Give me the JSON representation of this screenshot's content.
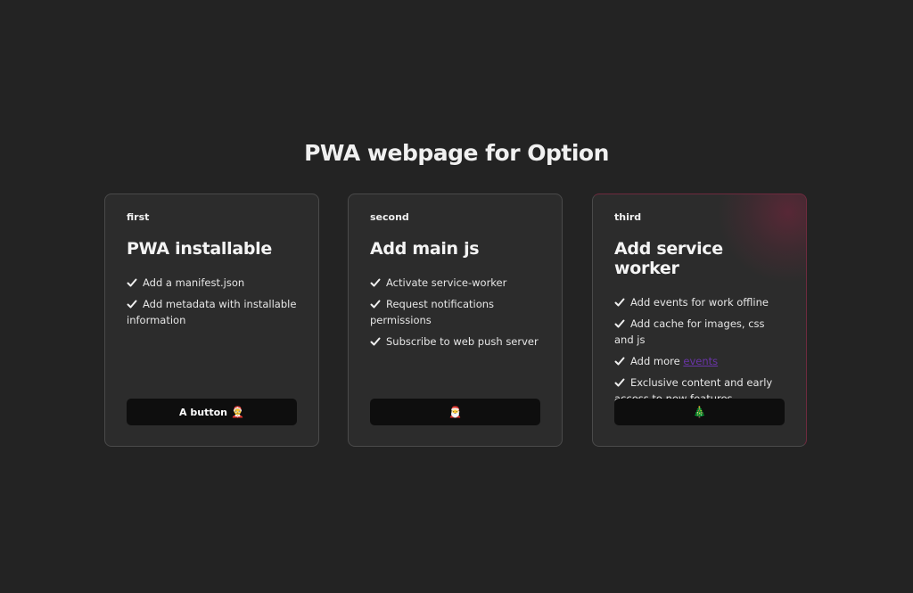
{
  "page": {
    "title": "PWA webpage for Option"
  },
  "cards": [
    {
      "label": "first",
      "heading": "PWA installable",
      "features": [
        "Add a manifest.json",
        "Add metadata with installable information"
      ],
      "button": {
        "label": "A button",
        "icon": "🤶"
      }
    },
    {
      "label": "second",
      "heading": "Add main js",
      "features": [
        "Activate service-worker",
        "Request notifications permissions",
        "Subscribe to web push server"
      ],
      "button": {
        "label": "",
        "icon": "🎅"
      }
    },
    {
      "label": "third",
      "heading": "Add service worker",
      "features": [
        "Add events for work offline",
        "Add cache for images, css and js",
        "Exclusive content and early access to new features"
      ],
      "feature_link": {
        "prefix": "Add more ",
        "link_text": "events"
      },
      "button": {
        "label": "",
        "icon": "🎄"
      }
    }
  ],
  "colors": {
    "background": "#232323",
    "card": "#2c2c2c",
    "button": "#0e0e0e",
    "link": "#6a35a8",
    "accent_glow": "#c81e50"
  }
}
